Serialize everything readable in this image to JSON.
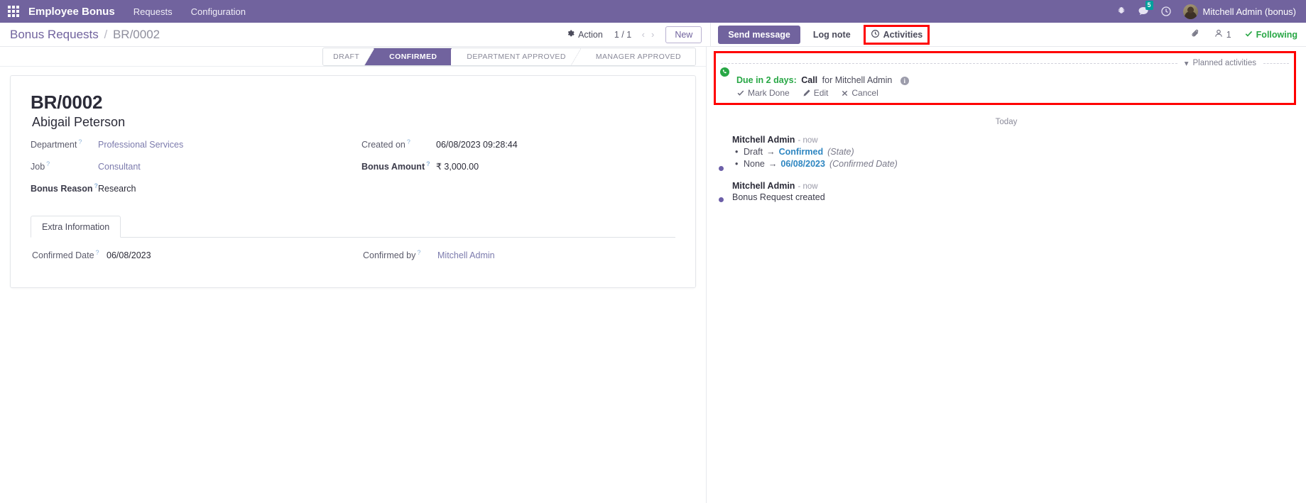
{
  "navbar": {
    "apps_icon": "apps-grid-icon",
    "brand": "Employee Bonus",
    "menus": [
      "Requests",
      "Configuration"
    ],
    "bug_icon": "bug-icon",
    "messages_icon": "messages-icon",
    "messages_count": "5",
    "activities_icon": "clock-icon",
    "user_name": "Mitchell Admin (bonus)",
    "brand_color": "#71639e"
  },
  "control_panel": {
    "breadcrumb_root": "Bonus Requests",
    "breadcrumb_sep": "/",
    "breadcrumb_current": "BR/0002",
    "action_label": "Action",
    "action_icon": "gear-icon",
    "pager": "1 / 1",
    "prev_icon": "chevron-left-icon",
    "next_icon": "chevron-right-icon",
    "new_label": "New"
  },
  "chatter_topbar": {
    "send_message": "Send message",
    "log_note": "Log note",
    "activities": "Activities",
    "activities_icon": "clock-icon",
    "attachment_icon": "paperclip-icon",
    "followers_icon": "user-icon",
    "followers_count": "1",
    "following_label": "Following",
    "following_icon": "check-icon",
    "highlight_color": "#ff0000"
  },
  "statusbar": {
    "steps": [
      {
        "label": "Draft",
        "active": false
      },
      {
        "label": "Confirmed",
        "active": true
      },
      {
        "label": "Department Approved",
        "active": false
      },
      {
        "label": "Manager Approved",
        "active": false
      }
    ]
  },
  "form": {
    "title": "BR/0002",
    "subtitle": "Abigail Peterson",
    "left_fields": [
      {
        "label": "Department",
        "help": "?",
        "value": "Professional Services",
        "style": "link",
        "required": false
      },
      {
        "label": "Job",
        "help": "?",
        "value": "Consultant",
        "style": "link",
        "required": false
      },
      {
        "label": "Bonus Reason",
        "help": "?",
        "value": "Research",
        "style": "text",
        "required": true
      }
    ],
    "right_fields": [
      {
        "label": "Created on",
        "help": "?",
        "value": "06/08/2023 09:28:44",
        "style": "text",
        "required": false
      },
      {
        "label": "Bonus Amount",
        "help": "?",
        "value": "₹ 3,000.00",
        "style": "text",
        "required": true
      }
    ],
    "notebook": {
      "tabs": [
        "Extra Information"
      ],
      "page_left": [
        {
          "label": "Confirmed Date",
          "help": "?",
          "value": "06/08/2023",
          "style": "text",
          "required": false
        }
      ],
      "page_right": [
        {
          "label": "Confirmed by",
          "help": "?",
          "value": "Mitchell Admin",
          "style": "link",
          "required": false
        }
      ]
    }
  },
  "chatter": {
    "planned_activities_label": "Planned activities",
    "planned_caret_icon": "caret-down-icon",
    "activity": {
      "avatar": "user-avatar",
      "type_badge_icon": "phone-icon",
      "due": "Due in 2 days:",
      "type": "Call",
      "for_text": "for Mitchell Admin",
      "info_icon": "info-icon",
      "mark_done": "Mark Done",
      "mark_done_icon": "check-icon",
      "edit": "Edit",
      "edit_icon": "pencil-icon",
      "cancel": "Cancel",
      "cancel_icon": "close-icon"
    },
    "day_separator": "Today",
    "messages": [
      {
        "author": "Mitchell Admin",
        "time": "- now",
        "tracking": [
          {
            "old": "Draft",
            "arrow": "→",
            "new": "Confirmed",
            "field": "(State)"
          },
          {
            "old": "None",
            "arrow": "→",
            "new": "06/08/2023",
            "field": "(Confirmed Date)"
          }
        ],
        "body": ""
      },
      {
        "author": "Mitchell Admin",
        "time": "- now",
        "tracking": [],
        "body": "Bonus Request created"
      }
    ]
  }
}
